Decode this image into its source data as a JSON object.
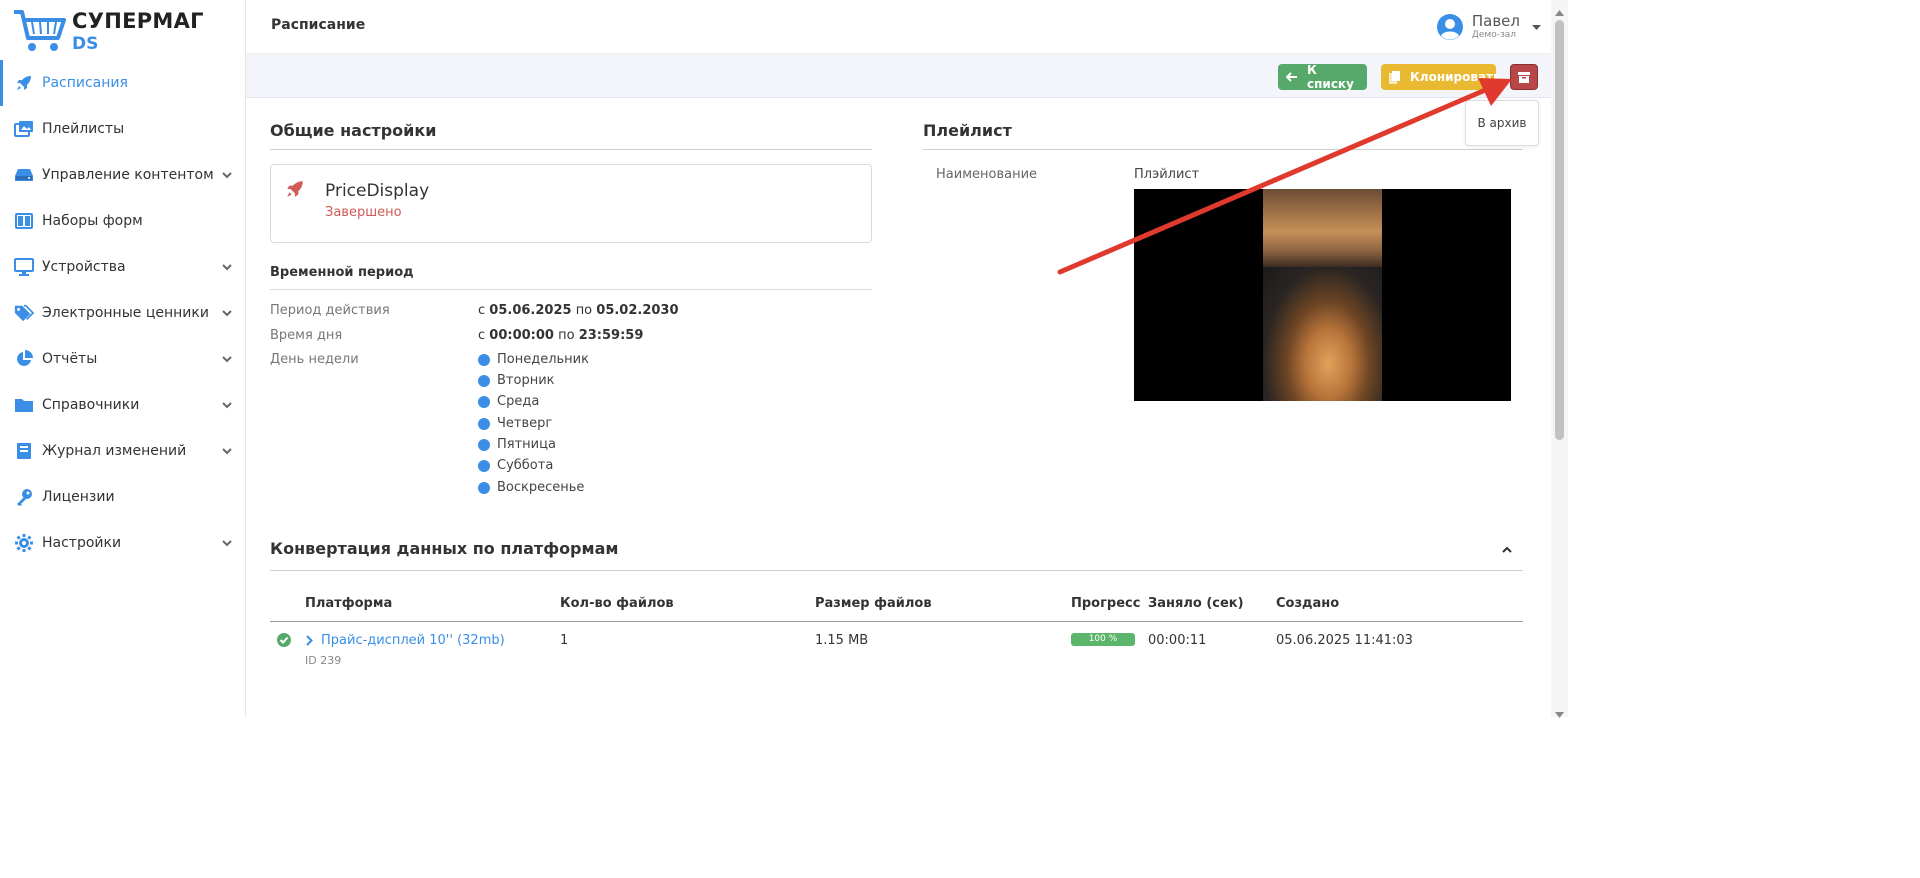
{
  "app": {
    "logo_line1": "СУПЕРМАГ",
    "logo_line2": "DS"
  },
  "sidebar": {
    "items": [
      {
        "label": "Расписания",
        "icon": "rocket-icon",
        "active": true,
        "has_chevron": false
      },
      {
        "label": "Плейлисты",
        "icon": "images-icon",
        "active": false,
        "has_chevron": false
      },
      {
        "label": "Управление контентом",
        "icon": "hard-drive-icon",
        "active": false,
        "has_chevron": true
      },
      {
        "label": "Наборы форм",
        "icon": "columns-icon",
        "active": false,
        "has_chevron": false
      },
      {
        "label": "Устройства",
        "icon": "monitor-icon",
        "active": false,
        "has_chevron": true
      },
      {
        "label": "Электронные ценники",
        "icon": "tags-icon",
        "active": false,
        "has_chevron": true
      },
      {
        "label": "Отчёты",
        "icon": "pie-chart-icon",
        "active": false,
        "has_chevron": true
      },
      {
        "label": "Справочники",
        "icon": "folder-icon",
        "active": false,
        "has_chevron": true
      },
      {
        "label": "Журнал изменений",
        "icon": "book-icon",
        "active": false,
        "has_chevron": true
      },
      {
        "label": "Лицензии",
        "icon": "key-icon",
        "active": false,
        "has_chevron": false
      },
      {
        "label": "Настройки",
        "icon": "gear-icon",
        "active": false,
        "has_chevron": true
      }
    ]
  },
  "header": {
    "title": "Расписание",
    "user_name": "Павел",
    "user_sub": "Демо-зал"
  },
  "actions": {
    "back_label": "К списку",
    "clone_label": "Клонировать",
    "archive_tooltip": "В архив"
  },
  "general": {
    "title": "Общие настройки",
    "name": "PriceDisplay",
    "status": "Завершено",
    "period_title": "Временной период",
    "validity_label": "Период действия",
    "validity_from": "05.06.2025",
    "validity_to": "05.02.2030",
    "time_label": "Время дня",
    "time_from": "00:00:00",
    "time_to": "23:59:59",
    "prefix_from": "с",
    "prefix_to": "по",
    "weekday_label": "День недели",
    "weekdays": [
      "Понедельник",
      "Вторник",
      "Среда",
      "Четверг",
      "Пятница",
      "Суббота",
      "Воскресенье"
    ]
  },
  "playlist": {
    "title": "Плейлист",
    "col_name": "Наименование",
    "col_playlist": "Плэйлист"
  },
  "conversion": {
    "title": "Конвертация данных по платформам",
    "columns": [
      "Платформа",
      "Кол-во файлов",
      "Размер файлов",
      "Прогресс",
      "Заняло (сек)",
      "Создано"
    ],
    "rows": [
      {
        "platform": "Прайс-дисплей 10'' (32mb)",
        "id": "ID 239",
        "files": "1",
        "size": "1.15 MB",
        "progress": "100 %",
        "duration": "00:00:11",
        "created": "05.06.2025 11:41:03"
      }
    ]
  },
  "colors": {
    "accent": "#3a8ee6",
    "success": "#57a86b",
    "warning": "#e8b931",
    "danger": "#b8474a",
    "annotation_arrow": "#e03a2f"
  }
}
